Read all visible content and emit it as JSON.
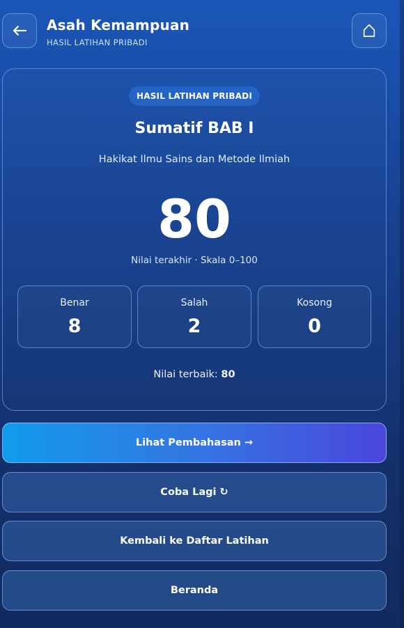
{
  "header": {
    "title": "Asah Kemampuan",
    "subtitle": "HASIL LATIHAN PRIBADI",
    "back_icon": "arrow-left-icon",
    "home_icon": "home-icon"
  },
  "result": {
    "badge": "HASIL LATIHAN PRIBADI",
    "quiz_title": "Sumatif BAB I",
    "topic": "Hakikat Ilmu Sains dan Metode Ilmiah",
    "score": "80",
    "score_caption": "Nilai terakhir · Skala 0–100",
    "stats": [
      {
        "label": "Benar",
        "value": "8"
      },
      {
        "label": "Salah",
        "value": "2"
      },
      {
        "label": "Kosong",
        "value": "0"
      }
    ],
    "best_label": "Nilai terbaik:",
    "best_value": "80"
  },
  "actions": {
    "review": "Lihat Pembahasan →",
    "retry": "Coba Lagi ↻",
    "back_to_list": "Kembali ke Daftar Latihan",
    "home": "Beranda"
  },
  "colors": {
    "background_top": "#1a56b8",
    "background_bottom": "#122a5e",
    "primary_gradient_start": "#129bec",
    "primary_gradient_end": "#4b46dc"
  }
}
